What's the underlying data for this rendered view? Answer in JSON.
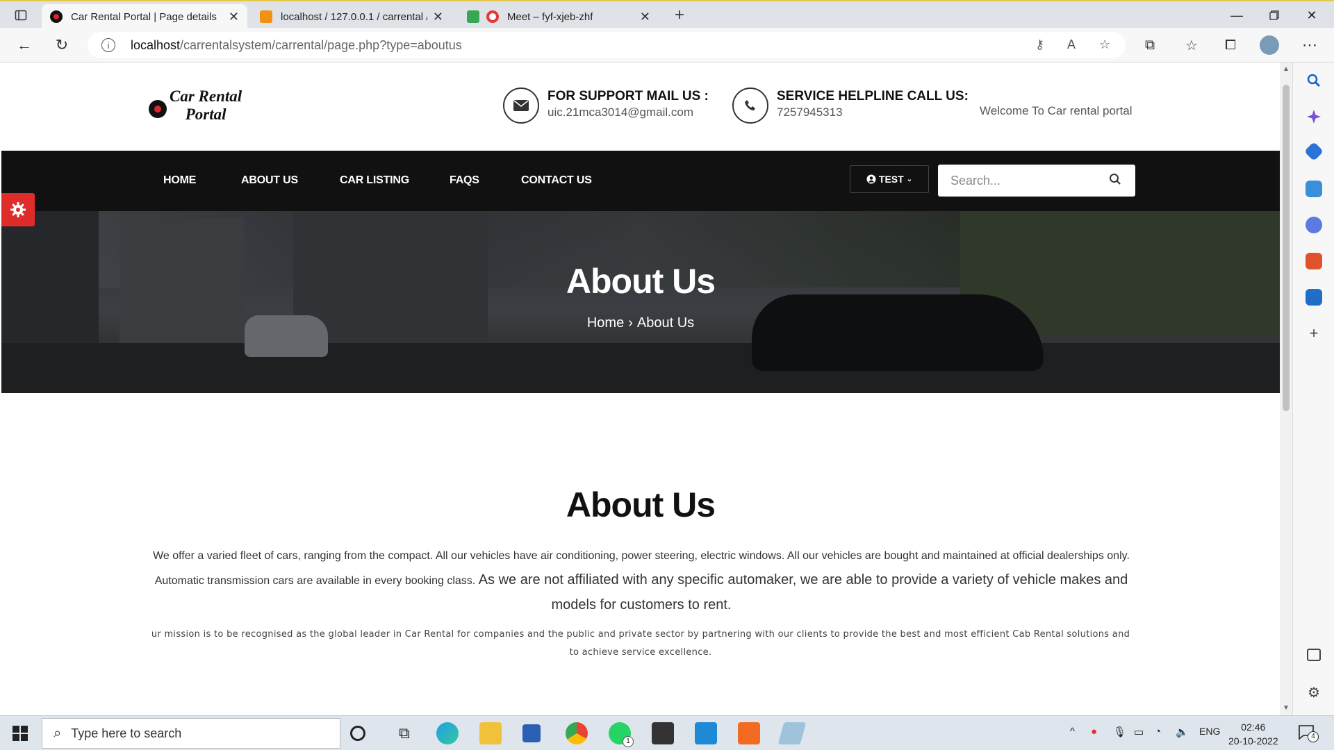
{
  "browser": {
    "tabs": [
      {
        "title": "Car Rental Portal | Page details",
        "favicon_color": "#111111"
      },
      {
        "title": "localhost / 127.0.0.1 / carrental /",
        "favicon_color": "#f29111"
      },
      {
        "title": "Meet – fyf-xjeb-zhf",
        "favicon_color": "#e53935"
      }
    ],
    "url_host": "localhost",
    "url_path": "/carrentalsystem/carrental/page.php?type=aboutus"
  },
  "site": {
    "logo_line1": "Car Rental",
    "logo_line2": "Portal",
    "support_label": "FOR SUPPORT MAIL US :",
    "support_email": "uic.21mca3014@gmail.com",
    "helpline_label": "SERVICE HELPLINE CALL US:",
    "helpline_phone": "7257945313",
    "welcome": "Welcome To Car rental portal"
  },
  "nav": {
    "items": [
      "HOME",
      "ABOUT US",
      "CAR LISTING",
      "FAQS",
      "CONTACT US"
    ],
    "user_label": "TEST",
    "search_placeholder": "Search..."
  },
  "hero": {
    "title": "About Us",
    "crumb_home": "Home",
    "crumb_sep": "›",
    "crumb_current": "About Us"
  },
  "about": {
    "heading": "About Us",
    "p1_small": "We offer a varied fleet of cars, ranging from the compact. All our vehicles have air conditioning,  power steering, electric windows. All our vehicles are bought and maintained at official dealerships only. Automatic transmission cars are available in every booking class.",
    "p1_big": "As we are not affiliated with any specific automaker, we are able to provide a variety of vehicle makes and models for customers to rent.",
    "p2": "ur mission is to be recognised as the global leader in Car Rental for companies and the public and private sector by partnering with our clients to provide the best and most efficient Cab Rental solutions and to achieve service excellence."
  },
  "taskbar": {
    "search_placeholder": "Type here to search",
    "lang": "ENG",
    "time": "02:46",
    "date": "20-10-2022",
    "notification_count": "4",
    "whatsapp_badge": "1"
  },
  "colors": {
    "nav_bg": "#111111",
    "accent_red": "#e02b2b"
  }
}
